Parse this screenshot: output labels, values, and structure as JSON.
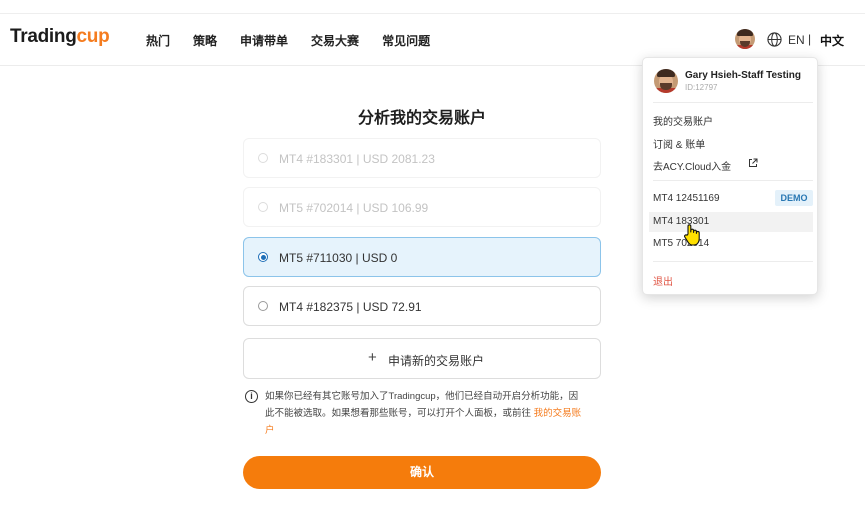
{
  "header": {
    "logo_part1": "Trading",
    "logo_part2": "cup",
    "nav": [
      "热门",
      "策略",
      "申请带单",
      "交易大赛",
      "常见问题"
    ],
    "lang_en": "EN",
    "lang_sep": "|",
    "lang_zh": "中文"
  },
  "main": {
    "title": "分析我的交易账户",
    "accounts": [
      {
        "label": "MT4 #183301 | USD 2081.23",
        "state": "disabled"
      },
      {
        "label": "MT5 #702014 | USD 106.99",
        "state": "disabled"
      },
      {
        "label": "MT5 #711030 | USD 0",
        "state": "selected"
      },
      {
        "label": "MT4 #182375 | USD 72.91",
        "state": "default"
      }
    ],
    "new_account_plus": "+",
    "new_account_label": "申请新的交易账户",
    "info_icon_glyph": "i",
    "notice_line1": "如果你已经有其它账号加入了Tradingcup，他们已经自动开启分析功能，因",
    "notice_line2": "此不能被选取。如果想看那些账号，可以打开个人面板，或前往 ",
    "notice_link_a": "我的交易账",
    "notice_link_b": "户",
    "confirm_label": "确认"
  },
  "dropdown": {
    "user_name": "Gary Hsieh-Staff Testing",
    "user_id": "ID:12797",
    "menu": {
      "my_accounts": "我的交易账户",
      "subscriptions": "订阅 & 账单",
      "deposit": "去ACY.Cloud入金"
    },
    "accounts": [
      {
        "label": "MT4 12451169",
        "badge": "DEMO"
      },
      {
        "label": "MT4 183301"
      },
      {
        "label": "MT5 702014"
      }
    ],
    "logout": "退出"
  },
  "colors": {
    "brand_orange": "#f57c0c",
    "selected_bg": "#e6f3fc",
    "selected_border": "#8cc4ea",
    "radio_blue": "#1f6fb8",
    "logout_red": "#e05544"
  },
  "icons": [
    "avatar",
    "globe-icon",
    "info-icon",
    "plus-icon",
    "external-link-icon",
    "hand-pointer-cursor"
  ]
}
